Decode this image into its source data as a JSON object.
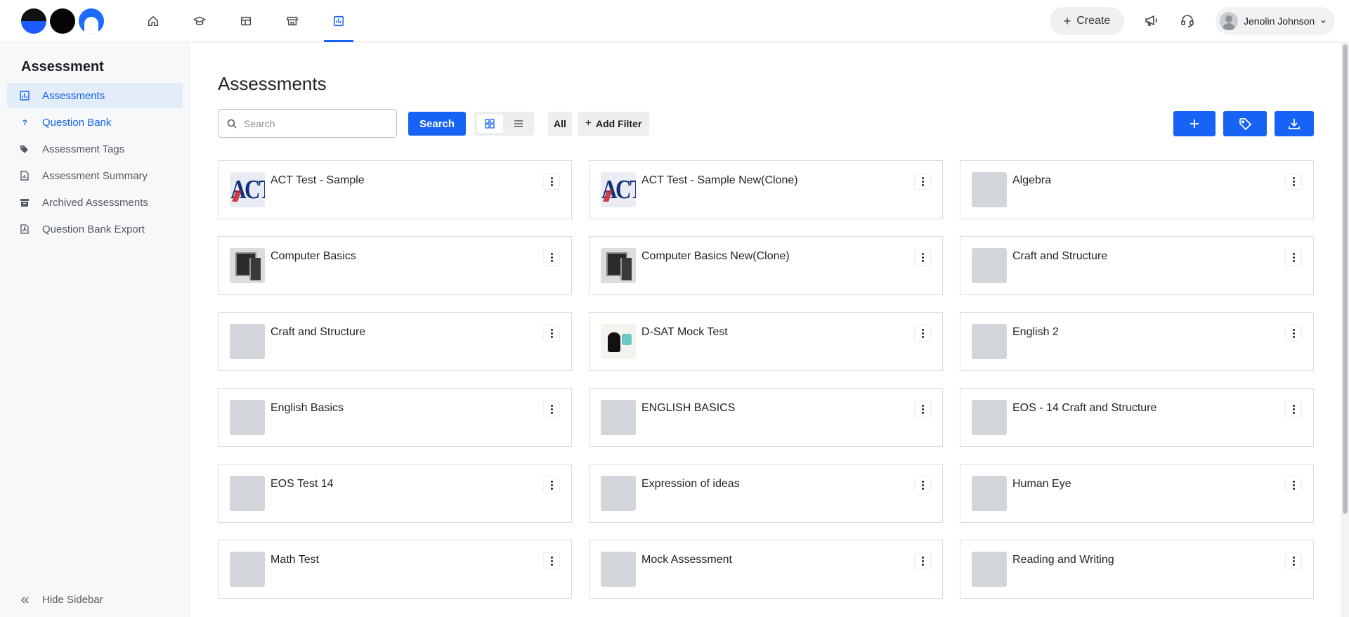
{
  "header": {
    "nav_icons": [
      "home-icon",
      "graduation-cap-icon",
      "layout-icon",
      "store-icon",
      "assessment-icon"
    ],
    "active_nav": "assessment-icon",
    "create_label": "Create",
    "user_name": "Jenolin Johnson",
    "accent_color": "#1763f5"
  },
  "sidebar": {
    "title": "Assessment",
    "items": [
      {
        "label": "Assessments",
        "icon": "chart-icon",
        "state": "active"
      },
      {
        "label": "Question Bank",
        "icon": "question-icon",
        "state": "link"
      },
      {
        "label": "Assessment Tags",
        "icon": "tags-icon",
        "state": "normal"
      },
      {
        "label": "Assessment Summary",
        "icon": "summary-doc-icon",
        "state": "normal"
      },
      {
        "label": "Archived Assessments",
        "icon": "archive-icon",
        "state": "normal"
      },
      {
        "label": "Question Bank Export",
        "icon": "pdf-file-icon",
        "state": "normal"
      }
    ],
    "hide_label": "Hide Sidebar"
  },
  "main": {
    "title": "Assessments",
    "search_placeholder": "Search",
    "search_button": "Search",
    "filter_all": "All",
    "add_filter": "Add Filter",
    "view_mode": "grid",
    "cards": [
      {
        "title": "ACT Test - Sample",
        "thumb": "act"
      },
      {
        "title": "ACT Test - Sample New(Clone)",
        "thumb": "act"
      },
      {
        "title": "Algebra",
        "thumb": "blank"
      },
      {
        "title": "Computer Basics",
        "thumb": "pc"
      },
      {
        "title": "Computer Basics New(Clone)",
        "thumb": "pc"
      },
      {
        "title": "Craft and Structure",
        "thumb": "blank"
      },
      {
        "title": "Craft and Structure",
        "thumb": "blank"
      },
      {
        "title": "D-SAT Mock Test",
        "thumb": "sat"
      },
      {
        "title": "English 2",
        "thumb": "blank"
      },
      {
        "title": "English Basics",
        "thumb": "blank"
      },
      {
        "title": "ENGLISH BASICS",
        "thumb": "blank"
      },
      {
        "title": "EOS - 14 Craft and Structure",
        "thumb": "blank"
      },
      {
        "title": "EOS Test 14",
        "thumb": "blank"
      },
      {
        "title": "Expression of ideas",
        "thumb": "blank"
      },
      {
        "title": "Human Eye",
        "thumb": "blank"
      },
      {
        "title": "Math Test",
        "thumb": "blank"
      },
      {
        "title": "Mock Assessment",
        "thumb": "blank"
      },
      {
        "title": "Reading and Writing",
        "thumb": "blank"
      }
    ],
    "thumb_text_act": "ACT"
  }
}
